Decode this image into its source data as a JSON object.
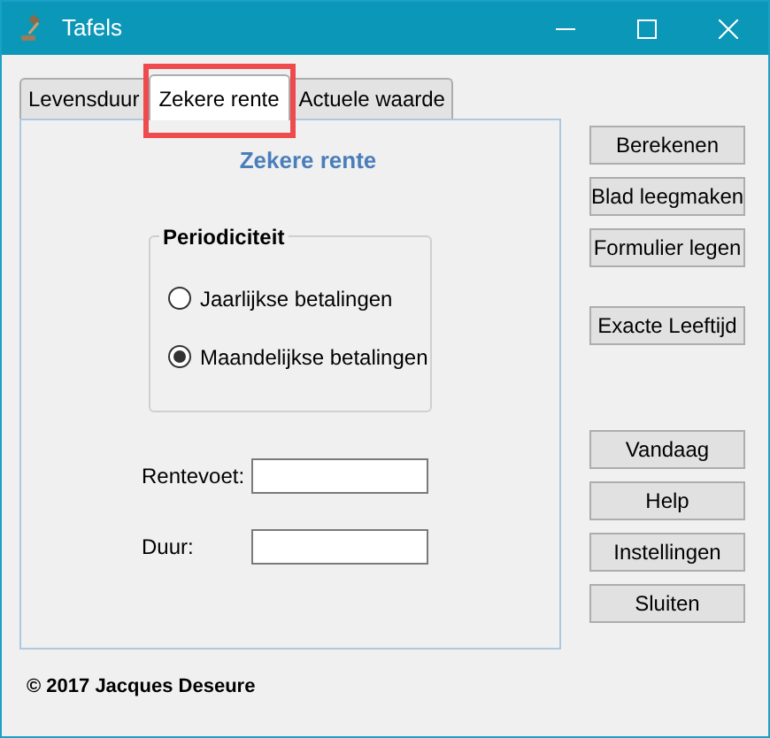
{
  "window": {
    "title": "Tafels"
  },
  "tabs": [
    {
      "label": "Levensduur",
      "selected": false
    },
    {
      "label": "Zekere rente",
      "selected": true,
      "highlighted": true
    },
    {
      "label": "Actuele waarde",
      "selected": false
    }
  ],
  "panel": {
    "heading": "Zekere rente",
    "group": {
      "title": "Periodiciteit",
      "options": [
        {
          "label": "Jaarlijkse betalingen",
          "selected": false
        },
        {
          "label": "Maandelijkse betalingen",
          "selected": true
        }
      ]
    },
    "fields": [
      {
        "label": "Rentevoet:"
      },
      {
        "label": "Duur:"
      }
    ]
  },
  "button_groups": [
    [
      "Berekenen",
      "Blad leegmaken",
      "Formulier legen"
    ],
    [
      "Exacte Leeftijd"
    ],
    [
      "Vandaag",
      "Help",
      "Instellingen",
      "Sluiten"
    ]
  ],
  "footer": "© 2017 Jacques Deseure"
}
